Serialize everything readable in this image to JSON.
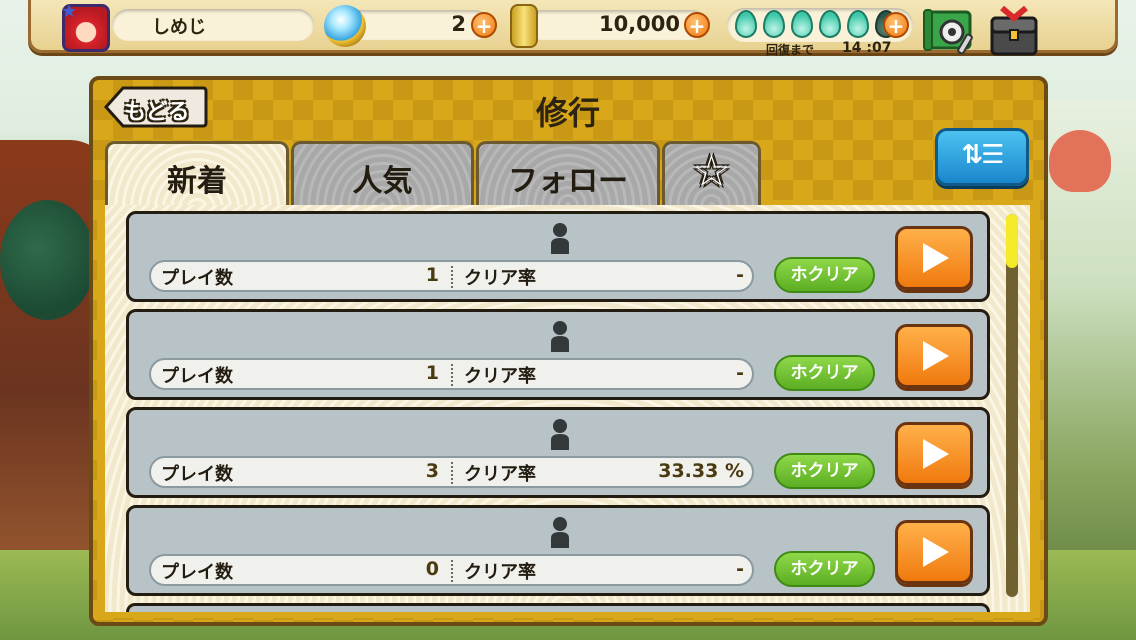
{
  "hud": {
    "player_name": "しめじ",
    "gems": "2",
    "coins": "10,000",
    "stamina": {
      "filled": 5,
      "total": 6
    },
    "recover_label": "回復まで",
    "recover_time": "14 :07"
  },
  "panel": {
    "back_label": "もどる",
    "title": "修行",
    "tabs": [
      {
        "label": "新着",
        "active": true
      },
      {
        "label": "人気",
        "active": false
      },
      {
        "label": "フォロー",
        "active": false
      },
      {
        "label": "",
        "icon": "star-icon",
        "active": false
      }
    ],
    "sort_icon": "sort-icon"
  },
  "stage_list": {
    "play_label": "プレイ数",
    "clear_rate_label": "クリア率",
    "clear_badge": "ホクリア",
    "rows": [
      {
        "plays": "1",
        "clear_rate": "-"
      },
      {
        "plays": "1",
        "clear_rate": "-"
      },
      {
        "plays": "3",
        "clear_rate": "33.33 %"
      },
      {
        "plays": "0",
        "clear_rate": "-"
      }
    ],
    "scroll_position": 0.0
  },
  "colors": {
    "accent_orange": "#f07a0e",
    "clear_green": "#5cae22",
    "panel_gold": "#d9a81a",
    "sort_blue": "#1a86cc"
  }
}
